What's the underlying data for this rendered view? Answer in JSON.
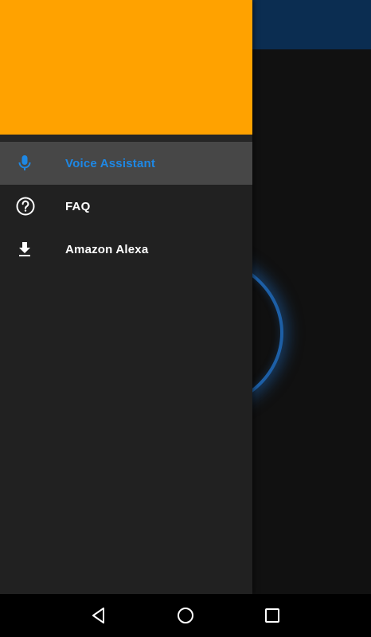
{
  "drawer": {
    "items": [
      {
        "label": "Voice Assistant",
        "icon": "microphone-icon",
        "active": true
      },
      {
        "label": "FAQ",
        "icon": "help-circle-icon",
        "active": false
      },
      {
        "label": "Amazon Alexa",
        "icon": "download-icon",
        "active": false
      }
    ]
  },
  "colors": {
    "header": "#ffa200",
    "toolbar": "#0b2d51",
    "accent": "#1e88e5",
    "drawer_bg": "#212121",
    "active_item_bg": "#474747"
  },
  "system_nav": {
    "buttons": [
      "back-icon",
      "home-icon",
      "recents-icon"
    ]
  }
}
